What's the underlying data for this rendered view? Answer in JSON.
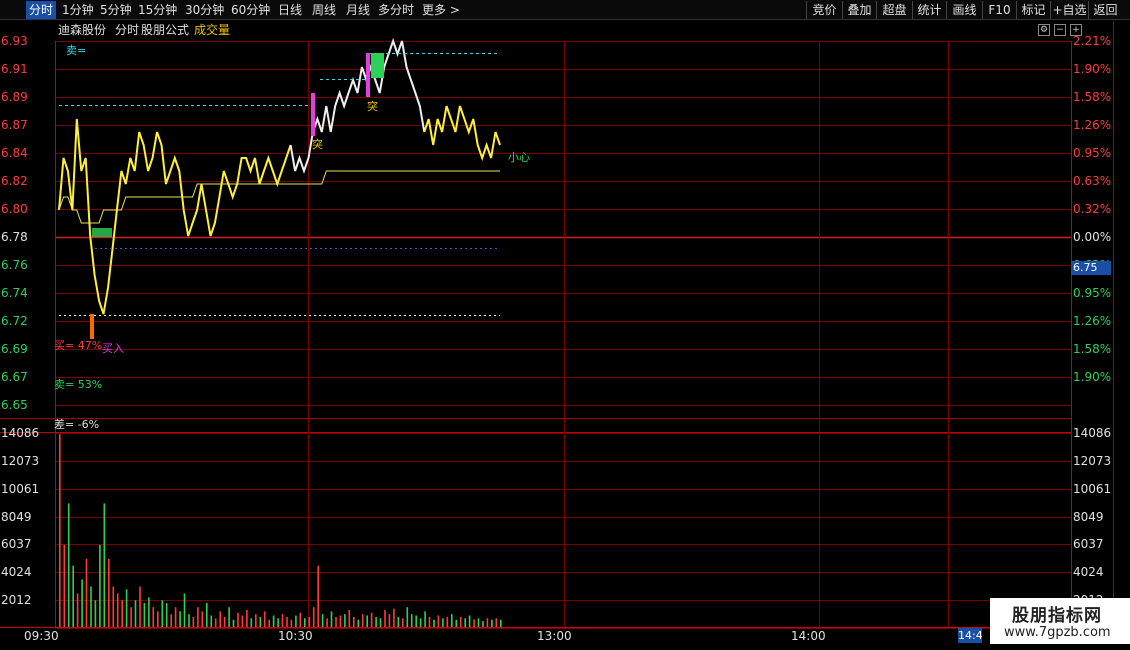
{
  "toolbar": {
    "timeframes": [
      "分时",
      "1分钟",
      "5分钟",
      "15分钟",
      "30分钟",
      "60分钟",
      "日线",
      "周线",
      "月线",
      "多分时",
      "更多 >"
    ],
    "active_timeframe": "分时",
    "buttons": [
      "竞价",
      "叠加",
      "超盘",
      "统计",
      "画线",
      "F10",
      "标记",
      "+自选",
      "返回"
    ]
  },
  "header": {
    "stock_name": "迪森股份",
    "mode": "分时",
    "formula": "股朋公式",
    "indicator": "成交量"
  },
  "price_axis": {
    "left_labels": [
      "6.93",
      "6.91",
      "6.89",
      "6.87",
      "6.84",
      "6.82",
      "6.80",
      "6.78",
      "6.76",
      "6.74",
      "6.72",
      "6.69",
      "6.67",
      "6.65"
    ],
    "right_labels": [
      "2.21%",
      "1.90%",
      "1.58%",
      "1.26%",
      "0.95%",
      "0.63%",
      "0.32%",
      "0.00%",
      "0.63%",
      "0.95%",
      "1.26%",
      "1.58%",
      "1.90%"
    ],
    "current_price": "6.75",
    "colors": {
      "up": "#ff3b3b",
      "down": "#2ed158",
      "flat": "#e0e0e0"
    }
  },
  "volume_axis": {
    "labels": [
      "14086",
      "12073",
      "10061",
      "8049",
      "6037",
      "4024",
      "2012"
    ],
    "right_labels": [
      "14086",
      "12073",
      "10061",
      "8049",
      "6037",
      "4024",
      "2012"
    ]
  },
  "time_axis": {
    "labels": [
      "09:30",
      "10:30",
      "13:00",
      "14:00"
    ],
    "current_time": "14:4"
  },
  "annotations": {
    "sell_top": "卖=",
    "breakout": "突",
    "caution": "小心",
    "buy_signal": "买入",
    "buy_pct": "买= 47%",
    "sell_pct": "卖= 53%",
    "diff": "差= -6%"
  },
  "chart_data": {
    "type": "line",
    "price_series": [
      6.8,
      6.84,
      6.83,
      6.8,
      6.87,
      6.83,
      6.84,
      6.78,
      6.75,
      6.73,
      6.72,
      6.74,
      6.77,
      6.8,
      6.83,
      6.82,
      6.84,
      6.83,
      6.86,
      6.85,
      6.83,
      6.84,
      6.86,
      6.85,
      6.82,
      6.83,
      6.84,
      6.83,
      6.8,
      6.78,
      6.79,
      6.8,
      6.82,
      6.8,
      6.78,
      6.79,
      6.81,
      6.83,
      6.82,
      6.81,
      6.82,
      6.84,
      6.84,
      6.83,
      6.84,
      6.82,
      6.83,
      6.84,
      6.83,
      6.82,
      6.83,
      6.84,
      6.85,
      6.83,
      6.84,
      6.83,
      6.84,
      6.86,
      6.87,
      6.86,
      6.88,
      6.86,
      6.88,
      6.89,
      6.88,
      6.89,
      6.9,
      6.89,
      6.91,
      6.9,
      6.91,
      6.9,
      6.89,
      6.91,
      6.92,
      6.93,
      6.92,
      6.93,
      6.91,
      6.9,
      6.89,
      6.88,
      6.86,
      6.87,
      6.85,
      6.87,
      6.86,
      6.88,
      6.87,
      6.86,
      6.88,
      6.87,
      6.86,
      6.87,
      6.85,
      6.84,
      6.85,
      6.84,
      6.86,
      6.85
    ],
    "avg_series": [
      6.8,
      6.81,
      6.81,
      6.8,
      6.8,
      6.79,
      6.79,
      6.79,
      6.79,
      6.79,
      6.8,
      6.8,
      6.8,
      6.8,
      6.8,
      6.81,
      6.81,
      6.81,
      6.81,
      6.81,
      6.81,
      6.81,
      6.81,
      6.81,
      6.81,
      6.81,
      6.81,
      6.81,
      6.81,
      6.81,
      6.81,
      6.82,
      6.82,
      6.82,
      6.82,
      6.82,
      6.82,
      6.82,
      6.82,
      6.82,
      6.82,
      6.82,
      6.82,
      6.82,
      6.82,
      6.82,
      6.82,
      6.82,
      6.82,
      6.82,
      6.82,
      6.82,
      6.82,
      6.82,
      6.82,
      6.82,
      6.82,
      6.82,
      6.82,
      6.82,
      6.83,
      6.83,
      6.83,
      6.83,
      6.83,
      6.83,
      6.83,
      6.83,
      6.83,
      6.83,
      6.83,
      6.83,
      6.83,
      6.83,
      6.83,
      6.83,
      6.83,
      6.83,
      6.83,
      6.83,
      6.83,
      6.83,
      6.83,
      6.83,
      6.83,
      6.83,
      6.83,
      6.83,
      6.83,
      6.83,
      6.83,
      6.83,
      6.83,
      6.83,
      6.83,
      6.83,
      6.83,
      6.83,
      6.83,
      6.83
    ],
    "prev_close": 6.78,
    "ylim": [
      6.65,
      6.93
    ],
    "volume_series": [
      14000,
      6000,
      9000,
      4500,
      2500,
      3500,
      5000,
      3000,
      2000,
      6000,
      9000,
      5000,
      3000,
      2500,
      2000,
      2800,
      1500,
      2000,
      3000,
      1800,
      2200,
      1500,
      1200,
      2000,
      1800,
      1000,
      1500,
      1200,
      2500,
      1000,
      800,
      1500,
      1200,
      1800,
      900,
      700,
      1200,
      800,
      1500,
      600,
      1100,
      900,
      1300,
      700,
      1000,
      800,
      1200,
      600,
      900,
      700,
      1000,
      800,
      600,
      900,
      1100,
      700,
      800,
      1500,
      4500,
      1000,
      700,
      1200,
      800,
      900,
      1000,
      1300,
      800,
      600,
      1000,
      900,
      1100,
      800,
      700,
      1300,
      1000,
      1400,
      800,
      700,
      1500,
      1000,
      900,
      700,
      1200,
      800,
      600,
      900,
      700,
      800,
      1000,
      600,
      800,
      700,
      900,
      600,
      700,
      500,
      700,
      600,
      700,
      600
    ],
    "volume_ylim": [
      0,
      14086
    ]
  }
}
